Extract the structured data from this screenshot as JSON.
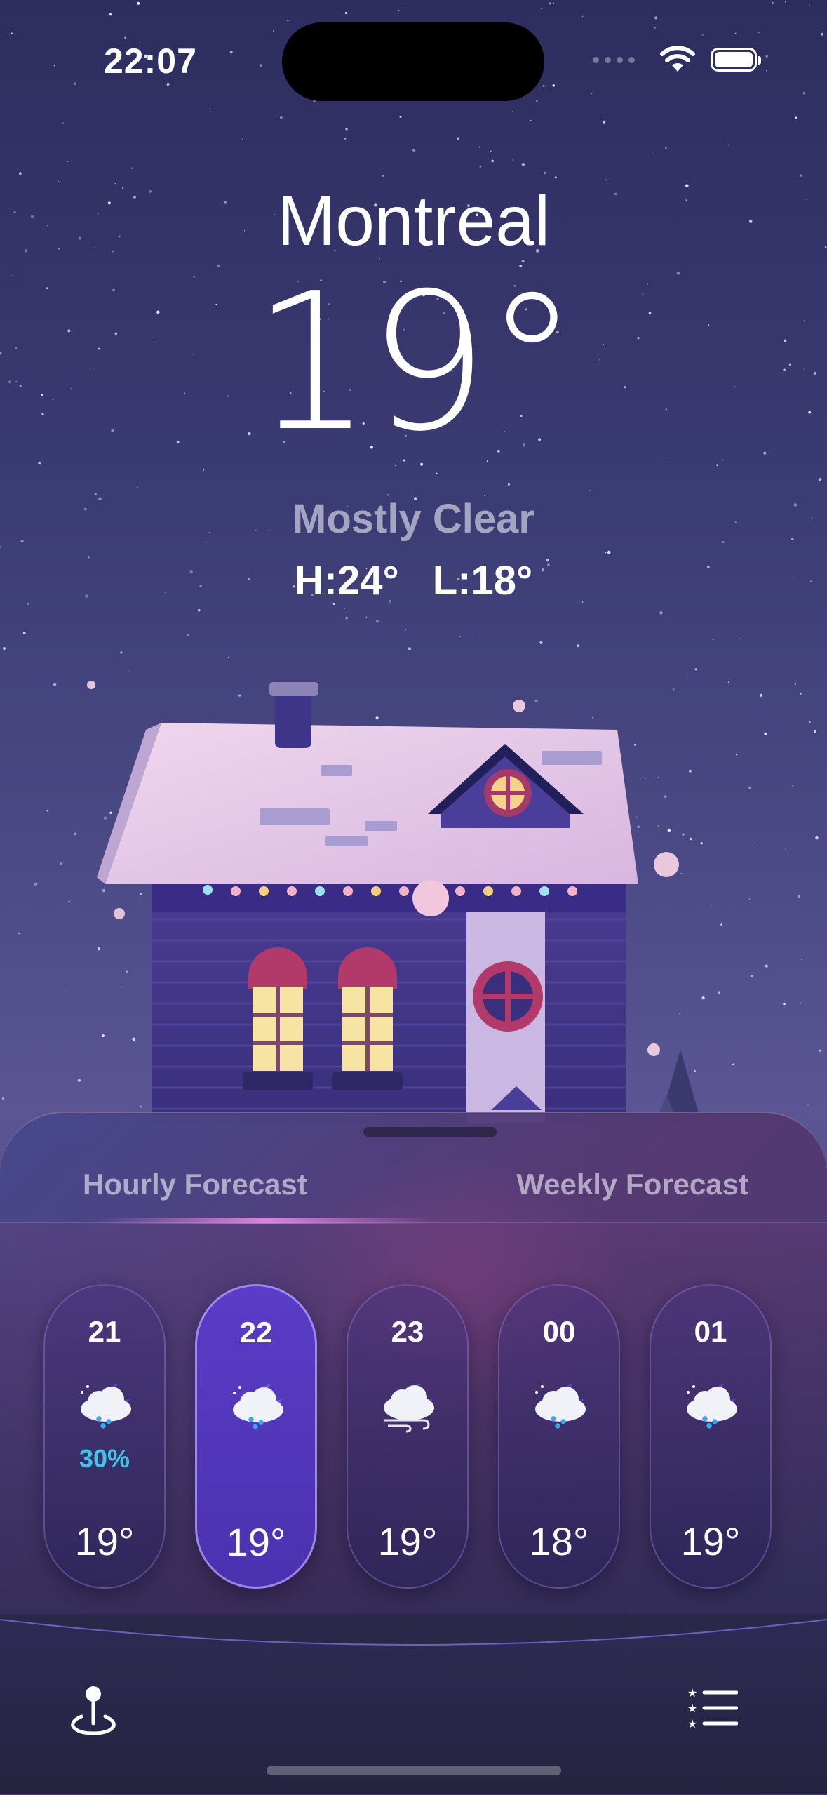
{
  "status_bar": {
    "time": "22:07"
  },
  "header": {
    "city": "Montreal",
    "temperature": "19°",
    "condition": "Mostly Clear",
    "high": "H:24°",
    "low": "L:18°"
  },
  "tabs": {
    "hourly": "Hourly Forecast",
    "weekly": "Weekly Forecast",
    "selected": "hourly"
  },
  "hourly": [
    {
      "hour": "21",
      "icon": "night-cloud-rain-icon",
      "precip": "30%",
      "temp": "19°",
      "active": false
    },
    {
      "hour": "22",
      "icon": "night-cloud-rain-icon",
      "precip": "",
      "temp": "19°",
      "active": true
    },
    {
      "hour": "23",
      "icon": "night-cloud-wind-icon",
      "precip": "",
      "temp": "19°",
      "active": false
    },
    {
      "hour": "00",
      "icon": "night-cloud-rain-icon",
      "precip": "",
      "temp": "18°",
      "active": false
    },
    {
      "hour": "01",
      "icon": "night-cloud-rain-icon",
      "precip": "",
      "temp": "19°",
      "active": false
    }
  ],
  "colors": {
    "accent": "#5a3cc6",
    "precip": "#3fc6e6",
    "sky_top": "#2e2d5f",
    "sky_bottom": "#5b5594"
  }
}
